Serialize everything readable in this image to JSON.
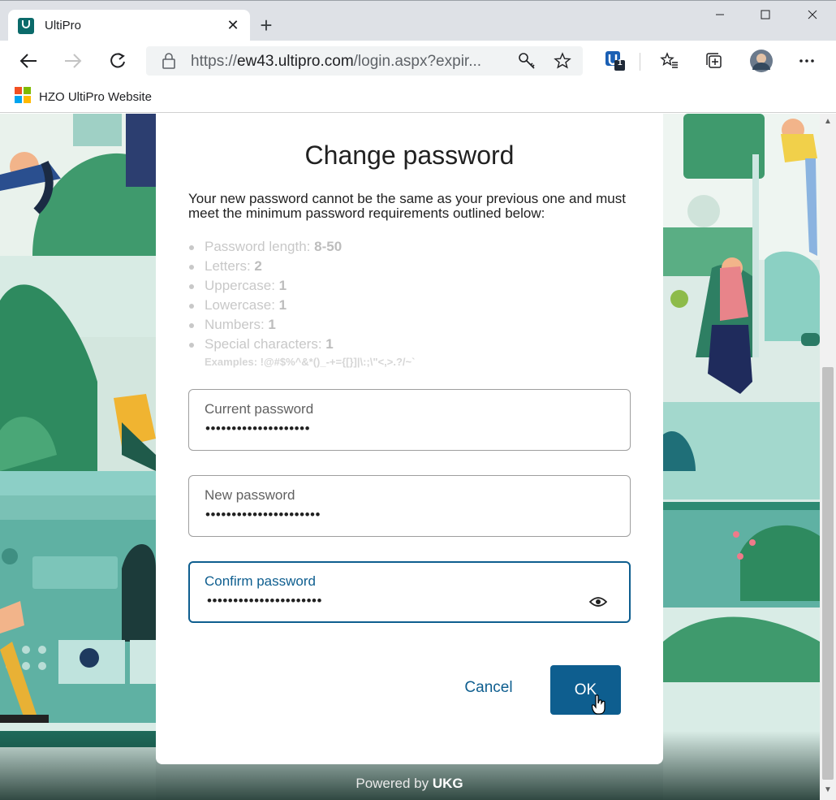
{
  "browser": {
    "tab_title": "UltiPro",
    "url_prefix": "https://",
    "url_host": "ew43.ultipro.com",
    "url_path": "/login.aspx?expir...",
    "bookmark_label": "HZO UltiPro Website",
    "extension_badge": "1"
  },
  "dialog": {
    "title": "Change password",
    "description": "Your new password cannot be the same as your previous one and must meet the minimum password requirements outlined below:",
    "requirements": [
      {
        "label": "Password length: ",
        "value": "8-50"
      },
      {
        "label": "Letters: ",
        "value": "2"
      },
      {
        "label": "Uppercase: ",
        "value": "1"
      },
      {
        "label": "Lowercase: ",
        "value": "1"
      },
      {
        "label": "Numbers: ",
        "value": "1"
      },
      {
        "label": "Special characters: ",
        "value": "1"
      }
    ],
    "examples": "Examples: !@#$%^&*()_-+={[}]|\\:;\\\"<,>.?/~`",
    "fields": {
      "current": {
        "label": "Current password",
        "value": "••••••••••••••••••••"
      },
      "new": {
        "label": "New password",
        "value": "••••••••••••••••••••••"
      },
      "confirm": {
        "label": "Confirm password",
        "value": "••••••••••••••••••••••"
      }
    },
    "cancel_label": "Cancel",
    "ok_label": "OK"
  },
  "footer": {
    "powered_prefix": "Powered by ",
    "powered_brand": "UKG"
  },
  "colors": {
    "primary": "#0e5e8f",
    "background_teal": "#2f8f7a"
  }
}
